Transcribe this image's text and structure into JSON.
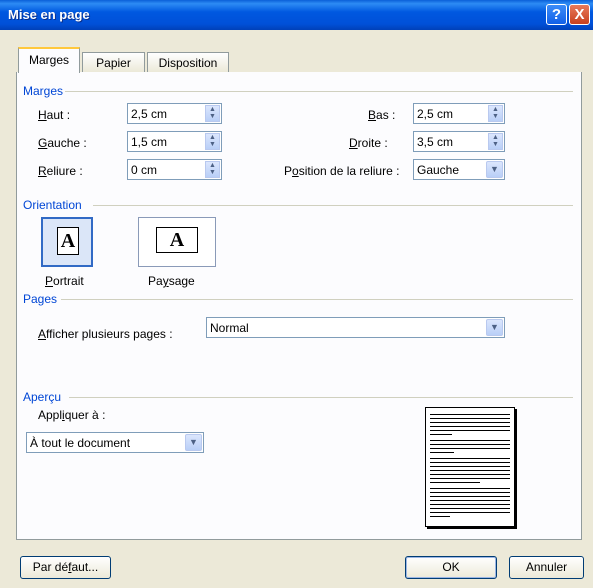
{
  "window": {
    "title": "Mise en page",
    "help_glyph": "?",
    "close_glyph": "X"
  },
  "tabs": [
    {
      "label": "Marges",
      "active": true
    },
    {
      "label": "Papier",
      "active": false
    },
    {
      "label": "Disposition",
      "active": false
    }
  ],
  "margins": {
    "section": "Marges",
    "haut": {
      "label_u": "H",
      "label": "aut :",
      "value": "2,5 cm"
    },
    "gauche": {
      "label_u": "G",
      "label": "auche :",
      "value": "1,5 cm"
    },
    "reliure": {
      "label_u": "R",
      "label": "eliure :",
      "value": "0 cm"
    },
    "bas": {
      "label_u": "B",
      "label": "as :",
      "value": "2,5 cm"
    },
    "droite": {
      "label_u": "D",
      "label": "roite :",
      "value": "3,5 cm"
    },
    "position": {
      "label_pre": "P",
      "label_u": "o",
      "label": "sition de la reliure :",
      "value": "Gauche"
    }
  },
  "orientation": {
    "section": "Orientation",
    "portrait": {
      "label_u": "P",
      "label": "ortrait",
      "glyph": "A",
      "selected": true
    },
    "paysage": {
      "label_pre": "Pa",
      "label_u": "y",
      "label": "sage",
      "glyph": "A",
      "selected": false
    }
  },
  "pages": {
    "section": "Pages",
    "multi_label_u": "A",
    "multi_label": "fficher plusieurs pages :",
    "multi_value": "Normal"
  },
  "apercu": {
    "section": "Aperçu",
    "apply_pre": "Appl",
    "apply_u": "i",
    "apply_post": "quer à :",
    "apply_value": "À tout le document"
  },
  "buttons": {
    "default_pre": "Par dé",
    "default_u": "f",
    "default_post": "aut...",
    "ok": "OK",
    "cancel": "Annuler"
  }
}
